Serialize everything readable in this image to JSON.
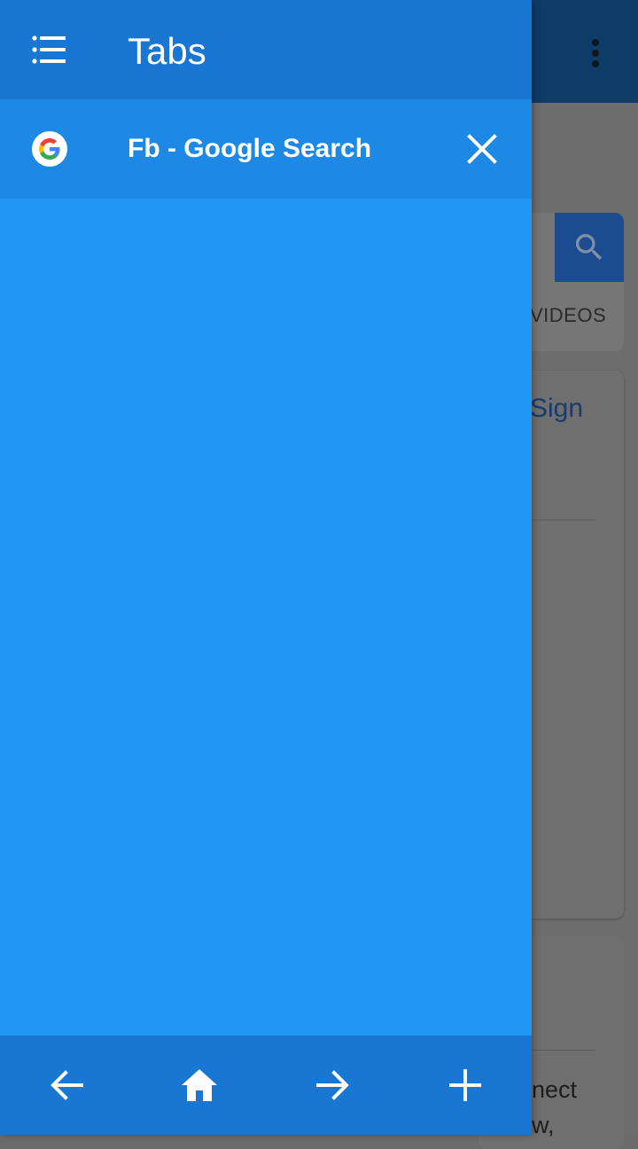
{
  "drawer": {
    "title": "Tabs",
    "tabs": [
      {
        "title": "Fb - Google Search",
        "favicon": "google-icon"
      }
    ],
    "footer": {
      "buttons": [
        "back-arrow-icon",
        "home-icon",
        "forward-arrow-icon",
        "plus-icon"
      ]
    }
  },
  "background": {
    "videos_label": "VIDEOS",
    "sign_text": "Sign",
    "snippet_line1": "nect",
    "snippet_line2": "w,"
  },
  "colors": {
    "drawer": "#2196f3",
    "drawer_header": "#1976d2",
    "tab_row": "#1e88e5"
  }
}
